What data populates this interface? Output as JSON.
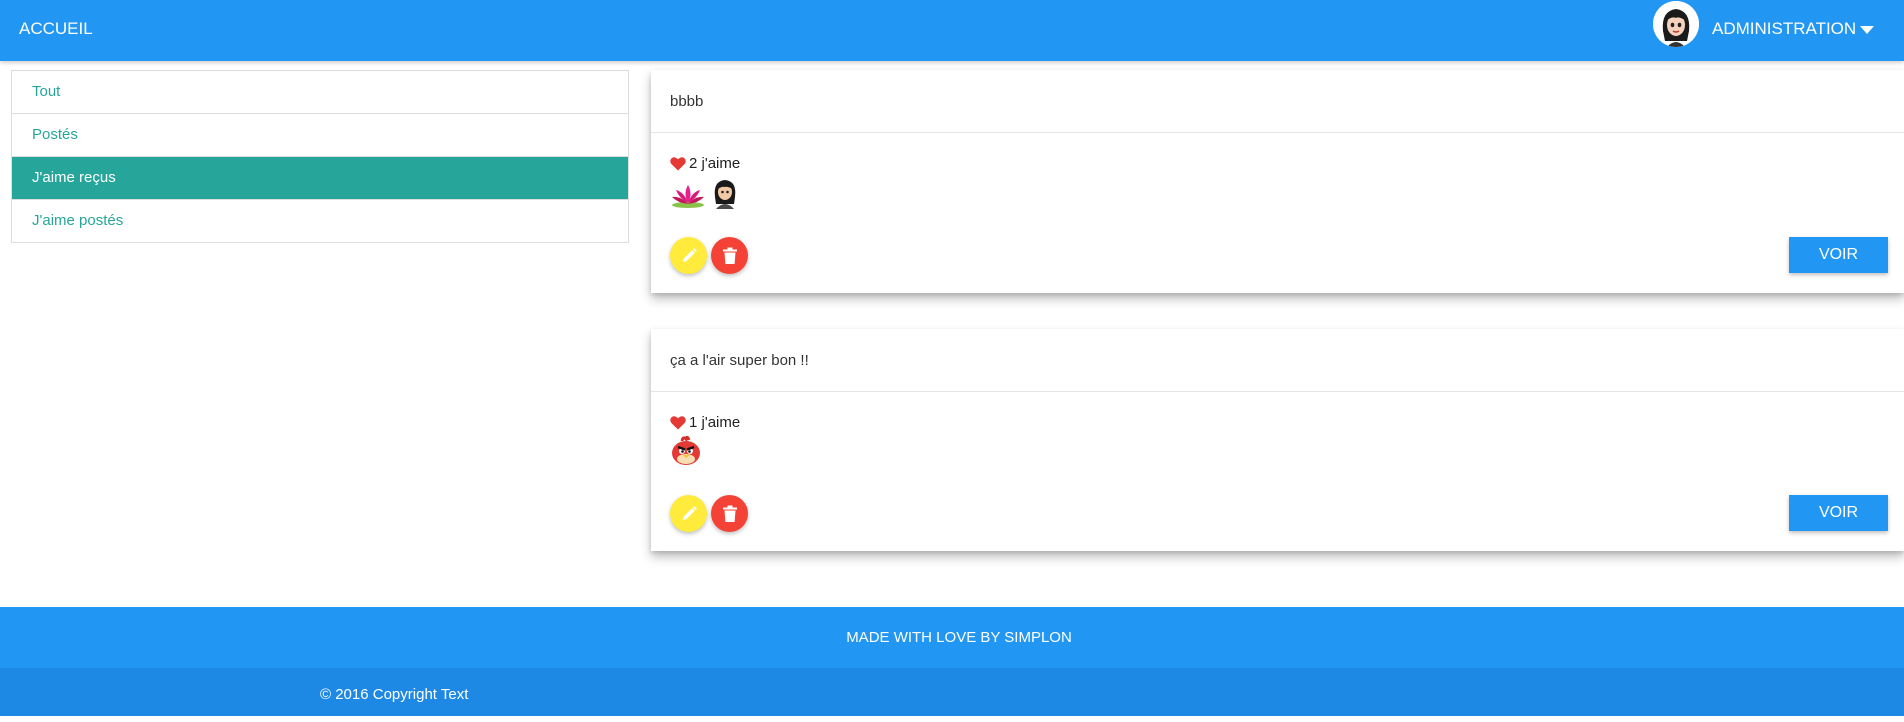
{
  "nav": {
    "home_label": "ACCUEIL",
    "user_label": "ADMINISTRATION",
    "avatar_icon": "user-avatar-icon",
    "dropdown_icon": "caret-down-icon"
  },
  "sidebar": {
    "items": [
      {
        "label": "Tout",
        "active": false
      },
      {
        "label": "Postés",
        "active": false
      },
      {
        "label": "J'aime reçus",
        "active": true
      },
      {
        "label": "J'aime postés",
        "active": false
      }
    ]
  },
  "posts": [
    {
      "title": "bbbb",
      "likes_label": "2 j'aime",
      "likers": [
        "lotus-flower-icon",
        "user-avatar-icon"
      ],
      "voir_label": "VOIR"
    },
    {
      "title": "ça a l'air super bon !!",
      "likes_label": "1 j'aime",
      "likers": [
        "angry-bird-icon"
      ],
      "voir_label": "VOIR"
    }
  ],
  "footer": {
    "made_label": "MADE WITH LOVE BY SIMPLON",
    "copyright": "© 2016 Copyright Text"
  },
  "colors": {
    "primary": "#2196f3",
    "primary_dark": "#1e88e5",
    "teal": "#26a69a",
    "edit_yellow": "#ffeb3b",
    "delete_red": "#f44336",
    "heart_red": "#e53935"
  }
}
